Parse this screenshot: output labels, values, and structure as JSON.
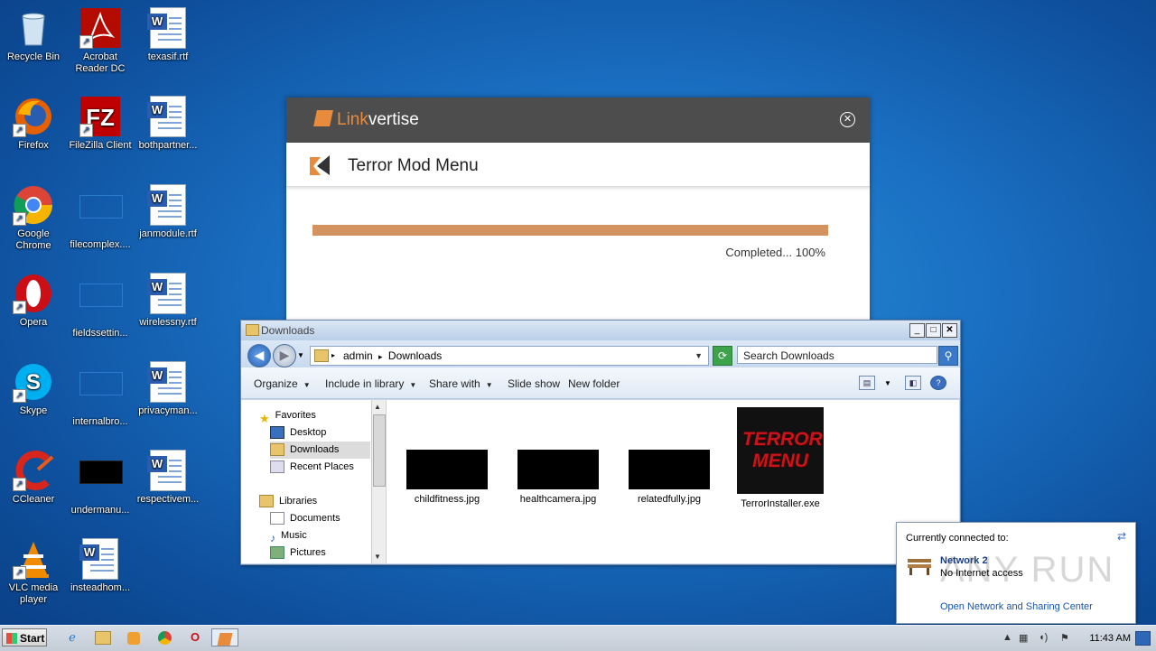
{
  "desktop": {
    "col1": [
      {
        "label": "Recycle Bin",
        "icon": "recycle-bin-icon"
      },
      {
        "label": "Firefox",
        "icon": "firefox-icon"
      },
      {
        "label": "Google Chrome",
        "icon": "chrome-icon"
      },
      {
        "label": "Opera",
        "icon": "opera-icon"
      },
      {
        "label": "Skype",
        "icon": "skype-icon"
      },
      {
        "label": "CCleaner",
        "icon": "ccleaner-icon"
      },
      {
        "label": "VLC media player",
        "icon": "vlc-icon"
      }
    ],
    "col2": [
      {
        "label": "Acrobat Reader DC",
        "icon": "acrobat-icon"
      },
      {
        "label": "FileZilla Client",
        "icon": "filezilla-icon"
      },
      {
        "label": "filecomplex....",
        "icon": "blank-file-icon"
      },
      {
        "label": "fieldssettin...",
        "icon": "blank-file-icon"
      },
      {
        "label": "internalbro...",
        "icon": "blank-file-icon"
      },
      {
        "label": "undermanu...",
        "icon": "black-thumbnail-icon"
      },
      {
        "label": "insteadhom...",
        "icon": "word-doc-icon"
      }
    ],
    "col3": [
      {
        "label": "texasif.rtf",
        "icon": "word-doc-icon"
      },
      {
        "label": "bothpartner...",
        "icon": "word-doc-icon"
      },
      {
        "label": "janmodule.rtf",
        "icon": "word-doc-icon"
      },
      {
        "label": "wirelessny.rtf",
        "icon": "word-doc-icon"
      },
      {
        "label": "privacyman...",
        "icon": "word-doc-icon"
      },
      {
        "label": "respectivem...",
        "icon": "word-doc-icon"
      }
    ]
  },
  "linkvertise": {
    "brand_prefix": "Link",
    "brand_suffix": "vertise",
    "close_glyph": "✕",
    "title": "Terror Mod Menu",
    "progress_fraction": 1.0,
    "status": "Completed... 100%",
    "accent_color": "#d4935e"
  },
  "explorer": {
    "title": "Downloads",
    "buttons": {
      "minimize": "_",
      "maximize": "□",
      "close": "✕"
    },
    "address": {
      "root": "admin",
      "sep": "▸",
      "current": "Downloads"
    },
    "search_placeholder": "Search Downloads",
    "toolbar": {
      "organize": "Organize",
      "include": "Include in library",
      "share": "Share with",
      "slideshow": "Slide show",
      "newfolder": "New folder"
    },
    "nav": {
      "favorites": "Favorites",
      "desktop": "Desktop",
      "downloads": "Downloads",
      "recent": "Recent Places",
      "libraries": "Libraries",
      "documents": "Documents",
      "music": "Music",
      "pictures": "Pictures"
    },
    "files": [
      {
        "name": "childfitness.jpg",
        "icon": "image-thumbnail-icon"
      },
      {
        "name": "healthcamera.jpg",
        "icon": "image-thumbnail-icon"
      },
      {
        "name": "relatedfully.jpg",
        "icon": "image-thumbnail-icon"
      },
      {
        "name": "TerrorInstaller.exe",
        "icon": "terror-menu-icon",
        "thumb_text": "TERROR MENU"
      }
    ]
  },
  "network": {
    "heading": "Currently connected to:",
    "name": "Network 2",
    "status": "No Internet access",
    "link": "Open Network and Sharing Center",
    "watermark": "ANY RUN"
  },
  "taskbar": {
    "start": "Start",
    "clock": "11:43 AM",
    "apps": [
      "ie-icon",
      "explorer-icon",
      "media-player-icon",
      "chrome-icon",
      "opera-icon",
      "linkvertise-icon"
    ]
  }
}
